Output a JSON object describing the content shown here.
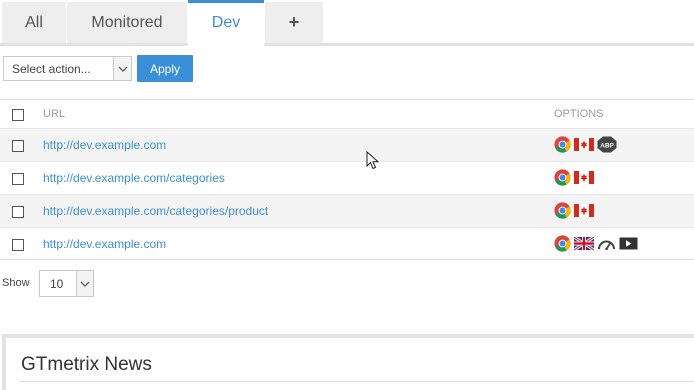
{
  "tabs": [
    {
      "label": "All"
    },
    {
      "label": "Monitored"
    },
    {
      "label": "Dev"
    },
    {
      "label": "+"
    }
  ],
  "actions": {
    "select_value": "Select action...",
    "apply_label": "Apply"
  },
  "table": {
    "columns": {
      "url": "URL",
      "options": "OPTIONS"
    },
    "rows": [
      {
        "url": "http://dev.example.com",
        "icons": [
          "chrome-icon",
          "canada-flag-icon",
          "adblock-plus-icon"
        ]
      },
      {
        "url": "http://dev.example.com/categories",
        "icons": [
          "chrome-icon",
          "canada-flag-icon"
        ]
      },
      {
        "url": "http://dev.example.com/categories/product",
        "icons": [
          "chrome-icon",
          "canada-flag-icon"
        ]
      },
      {
        "url": "http://dev.example.com",
        "icons": [
          "chrome-icon",
          "uk-flag-icon",
          "speedometer-icon",
          "video-icon"
        ]
      }
    ]
  },
  "pagination": {
    "show_label": "Show",
    "show_value": "10"
  },
  "news": {
    "title": "GTmetrix News"
  },
  "colors": {
    "accent": "#3b8fd9",
    "tab_bg": "#eeeeee",
    "row_alt": "#f4f4f4"
  }
}
